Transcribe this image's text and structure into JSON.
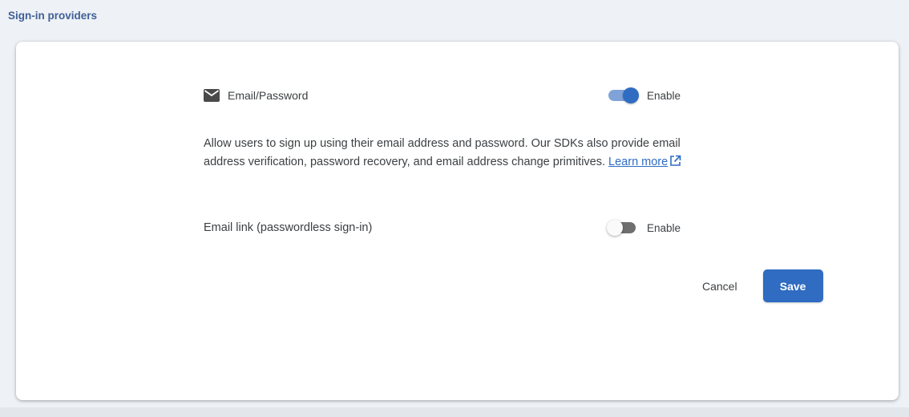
{
  "section": {
    "title": "Sign-in providers"
  },
  "providers": [
    {
      "icon": "mail-icon",
      "label": "Email/Password",
      "enabled": true,
      "toggle_label": "Enable"
    },
    {
      "label": "Email link (passwordless sign-in)",
      "enabled": false,
      "toggle_label": "Enable"
    }
  ],
  "description": {
    "text": "Allow users to sign up using their email address and password. Our SDKs also provide email address verification, password recovery, and email address change primitives.",
    "link_text": "Learn more",
    "link_icon": "external-link-icon"
  },
  "actions": {
    "cancel_label": "Cancel",
    "save_label": "Save"
  },
  "colors": {
    "accent": "#2f6cc2",
    "title": "#3f5f96",
    "text": "#3c4043"
  }
}
